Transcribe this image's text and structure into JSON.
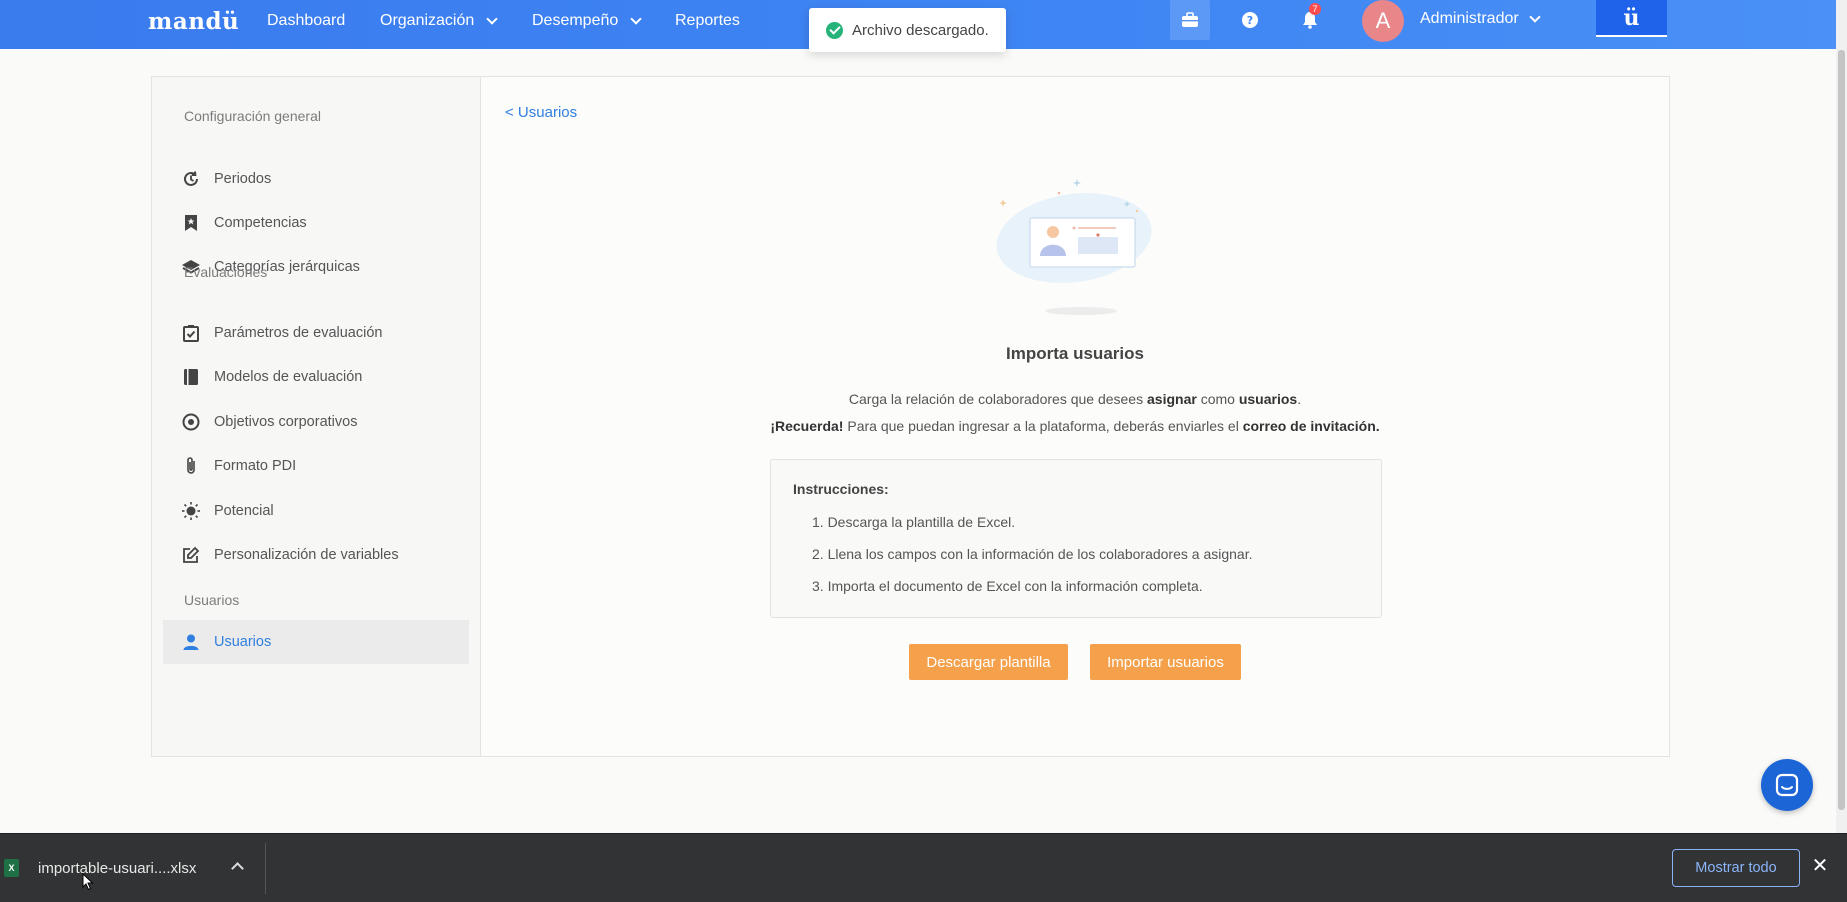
{
  "nav": {
    "logo": "mandü",
    "items": [
      {
        "label": "Dashboard",
        "dropdown": false
      },
      {
        "label": "Organización",
        "dropdown": true
      },
      {
        "label": "Desempeño",
        "dropdown": true
      },
      {
        "label": "Reportes",
        "dropdown": false
      }
    ],
    "notification_count": "7",
    "avatar_initial": "A",
    "user_name": "Administrador",
    "brand_button": "ü"
  },
  "toast": {
    "message": "Archivo descargado."
  },
  "sidebar": {
    "sections": [
      {
        "title": "Configuración general"
      },
      {
        "title": "Evaluaciones"
      },
      {
        "title": "Usuarios"
      }
    ],
    "items": [
      {
        "label": "Periodos",
        "icon": "history-icon"
      },
      {
        "label": "Competencias",
        "icon": "bookmark-icon"
      },
      {
        "label": "Categorías jerárquicas",
        "icon": "layers-icon"
      },
      {
        "label": "Parámetros de evaluación",
        "icon": "checklist-icon"
      },
      {
        "label": "Modelos de evaluación",
        "icon": "book-icon"
      },
      {
        "label": "Objetivos corporativos",
        "icon": "target-icon"
      },
      {
        "label": "Formato PDI",
        "icon": "paperclip-icon"
      },
      {
        "label": "Potencial",
        "icon": "bulb-icon"
      },
      {
        "label": "Personalización de variables",
        "icon": "edit-icon"
      },
      {
        "label": "Usuarios",
        "icon": "user-icon",
        "active": true
      }
    ]
  },
  "main": {
    "back_link": "< Usuarios",
    "title": "Importa usuarios",
    "line1": {
      "pre": "Carga la relación de colaboradores que desees ",
      "b1": "asignar",
      "mid": " como ",
      "b2": "usuarios",
      "post": "."
    },
    "line2": {
      "b1": "¡Recuerda!",
      "mid": " Para que puedan ingresar a la plataforma, deberás enviarles el ",
      "b2": "correo de invitación."
    },
    "instructions_title": "Instrucciones:",
    "steps": [
      "1. Descarga la plantilla de Excel.",
      "2. Llena los campos con la información de los colaboradores a asignar.",
      "3. Importa el documento de Excel con la información completa."
    ],
    "download_button": "Descargar plantilla",
    "import_button": "Importar usuarios"
  },
  "downloads": {
    "file_name": "importable-usuari....xlsx",
    "file_type_badge": "X",
    "show_all": "Mostrar todo",
    "close": "✕"
  },
  "colors": {
    "nav_blue": "#3f86f4",
    "accent_orange": "#f5a04a",
    "link_blue": "#2f7fe0",
    "success_green": "#26b37a"
  }
}
